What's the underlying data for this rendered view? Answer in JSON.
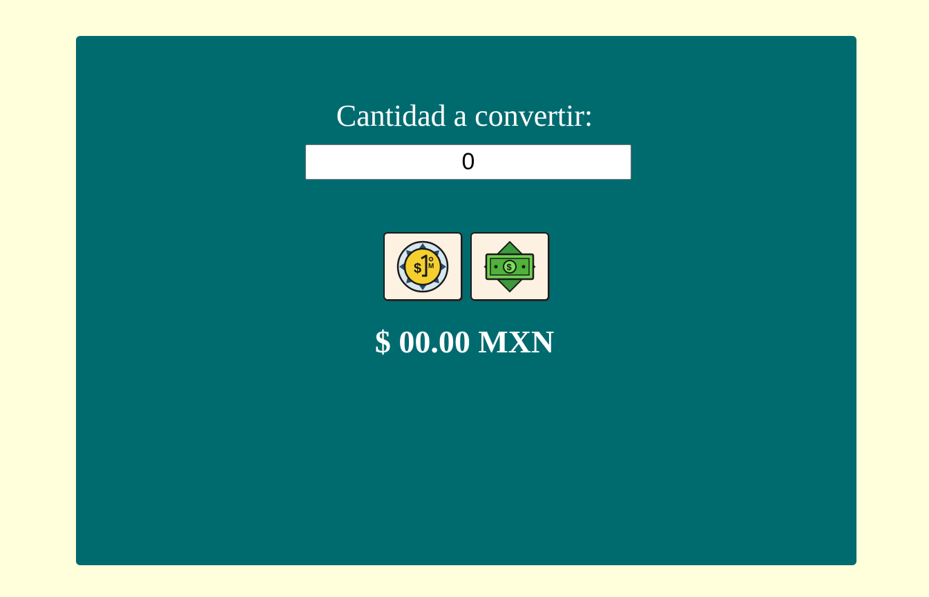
{
  "converter": {
    "label": "Cantidad a convertir:",
    "amount_value": "0",
    "result": "$ 00.00 MXN",
    "buttons": [
      {
        "icon": "peso-coin-icon",
        "action": "convert-to-coins"
      },
      {
        "icon": "dollar-bill-icon",
        "action": "convert-to-bills"
      }
    ]
  },
  "colors": {
    "page_background": "#ffffdc",
    "card_background": "#006b6f",
    "text": "#ffffff",
    "button_background": "#fdf1e2"
  }
}
